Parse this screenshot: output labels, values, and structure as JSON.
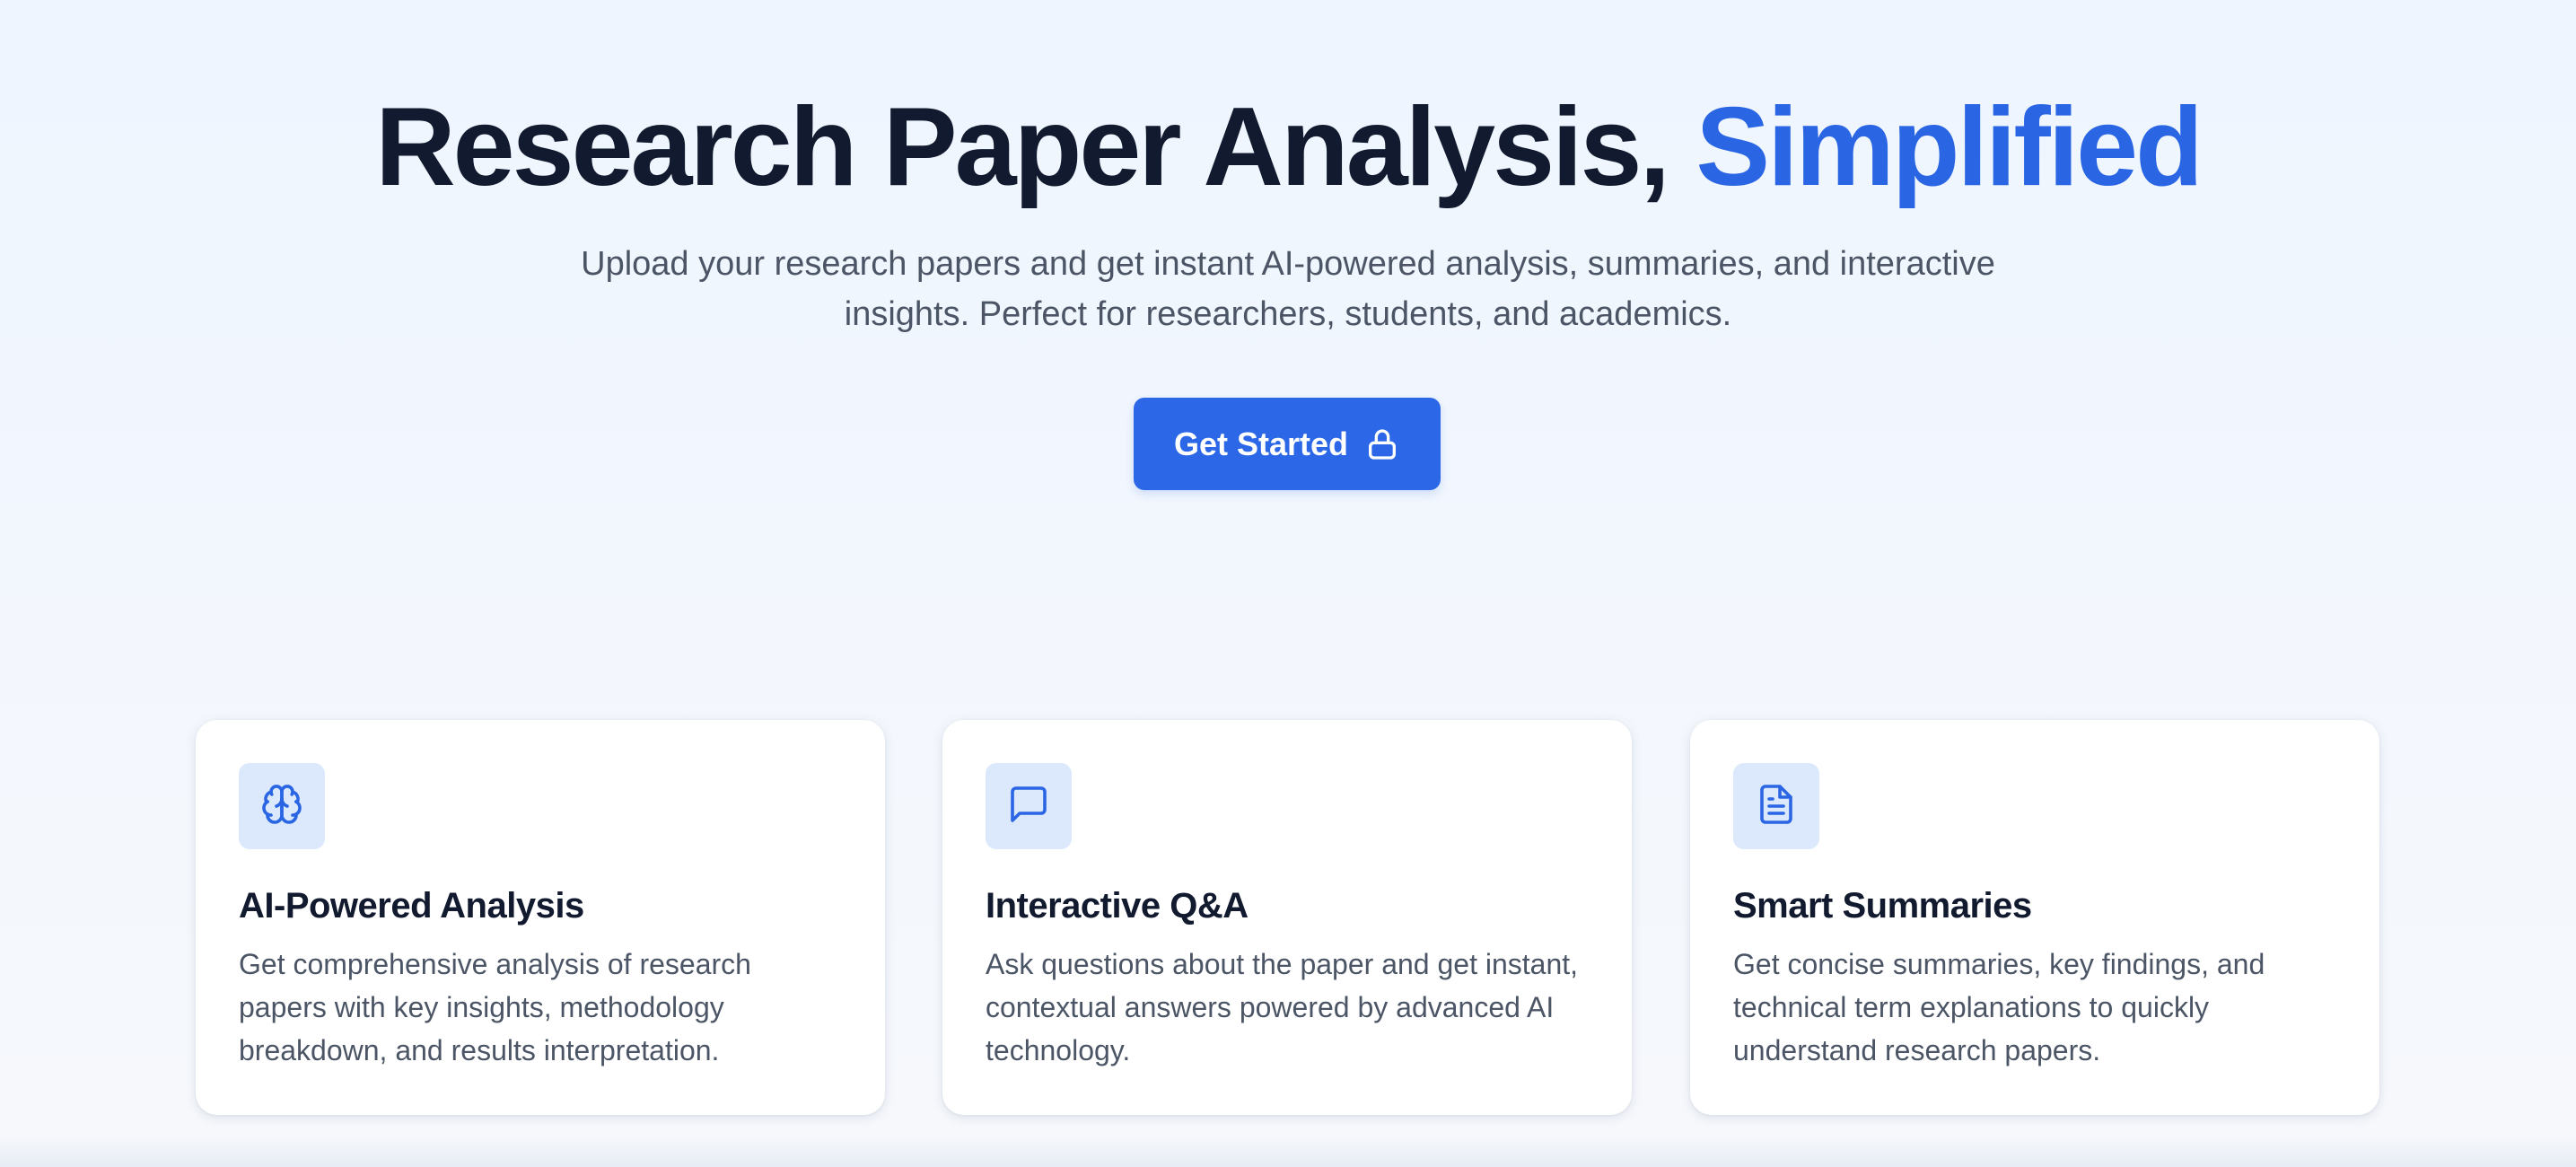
{
  "hero": {
    "title_main": "Research Paper Analysis,",
    "title_accent": "Simplified",
    "subtitle": "Upload your research papers and get instant AI-powered analysis, summaries, and interactive insights. Perfect for researchers, students, and academics.",
    "cta_label": "Get Started",
    "cta_icon": "lock-icon"
  },
  "features": [
    {
      "icon": "brain-icon",
      "title": "AI-Powered Analysis",
      "description": "Get comprehensive analysis of research papers with key insights, methodology breakdown, and results interpretation."
    },
    {
      "icon": "message-square-icon",
      "title": "Interactive Q&A",
      "description": "Ask questions about the paper and get instant, contextual answers powered by advanced AI technology."
    },
    {
      "icon": "file-text-icon",
      "title": "Smart Summaries",
      "description": "Get concise summaries, key findings, and technical term explanations to quickly understand research papers."
    }
  ],
  "colors": {
    "accent": "#2a66e3",
    "heading": "#111a2e",
    "body_text": "#4b5565",
    "icon_bg": "#dce9fc",
    "background": "#eef5ff"
  }
}
